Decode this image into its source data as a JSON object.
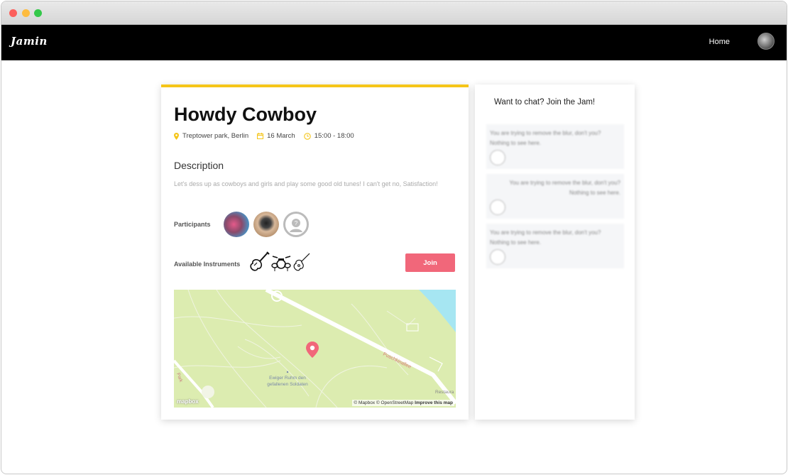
{
  "navbar": {
    "logo": "Jamin",
    "home_label": "Home"
  },
  "event": {
    "title": "Howdy Cowboy",
    "location": "Treptower park, Berlin",
    "date": "16 March",
    "time": "15:00 - 18:00",
    "description_heading": "Description",
    "description": "Let's dess up as cowboys and girls and play some good old tunes! I can't get no, Satisfaction!",
    "participants_label": "Participants",
    "instruments_label": "Available Instruments",
    "join_label": "Join"
  },
  "map": {
    "street_label": "Puschkinallee",
    "poi_label_1": "Ewiger Ruhm den",
    "poi_label_2": "gefallenen Soldaten",
    "park_label": "Park",
    "restaurant_label": "Restaura",
    "attribution": "© Mapbox © OpenStreetMap",
    "improve_label": "Improve this map",
    "logo": "mapbox"
  },
  "chat": {
    "title": "Want to chat? Join the Jam!",
    "messages": [
      {
        "line1": "You are trying to remove the blur, don't you?",
        "line2": "Nothing to see here."
      },
      {
        "line1": "You are trying to remove the blur, don't you?",
        "line2": "Nothing to see here."
      },
      {
        "line1": "You are trying to remove the blur, don't you?",
        "line2": "Nothing to see here."
      }
    ]
  },
  "colors": {
    "accent_yellow": "#f5c518",
    "join_pink": "#f1677a",
    "navbar": "#000000",
    "map_green": "#dcecb0"
  }
}
